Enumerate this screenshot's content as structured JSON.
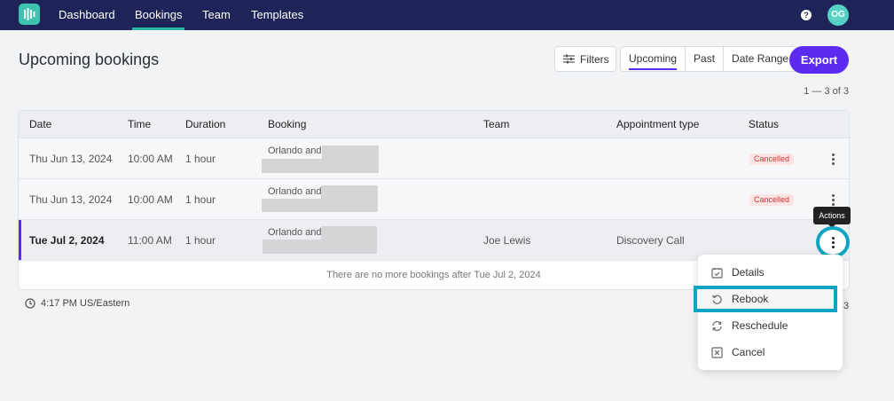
{
  "nav": {
    "items": [
      {
        "label": "Dashboard"
      },
      {
        "label": "Bookings"
      },
      {
        "label": "Team"
      },
      {
        "label": "Templates"
      }
    ],
    "help_label": "?",
    "avatar_initials": "OG",
    "accent": "#27b6a8",
    "bg": "#1f2458"
  },
  "page": {
    "title": "Upcoming bookings",
    "filters_label": "Filters",
    "tabs": [
      {
        "label": "Upcoming",
        "active": true
      },
      {
        "label": "Past",
        "active": false
      },
      {
        "label": "Date Range",
        "active": false
      }
    ],
    "export_label": "Export",
    "pagination": "1 — 3 of 3",
    "brand_color": "#5b2bf0"
  },
  "table": {
    "headers": [
      "Date",
      "Time",
      "Duration",
      "Booking",
      "Team",
      "Appointment type",
      "Status"
    ],
    "rows": [
      {
        "date": "Thu Jun 13, 2024",
        "time": "10:00 AM",
        "duration": "1 hour",
        "booking": "Orlando and",
        "team": "",
        "appointment_type": "",
        "status": "Cancelled"
      },
      {
        "date": "Thu Jun 13, 2024",
        "time": "10:00 AM",
        "duration": "1 hour",
        "booking": "Orlando and",
        "team": "",
        "appointment_type": "",
        "status": "Cancelled"
      },
      {
        "date": "Tue Jul 2, 2024",
        "time": "11:00 AM",
        "duration": "1 hour",
        "booking": "Orlando and",
        "team": "Joe Lewis",
        "appointment_type": "Discovery Call",
        "status": ""
      }
    ],
    "empty_message": "There are no more bookings after Tue Jul 2, 2024"
  },
  "tooltip": "Actions",
  "timezone": "4:17 PM US/Eastern",
  "footer_count_fragment": "3",
  "menu": {
    "items": [
      {
        "label": "Details",
        "icon": "checklist-icon"
      },
      {
        "label": "Rebook",
        "icon": "rotate-ccw-icon",
        "highlighted": true
      },
      {
        "label": "Reschedule",
        "icon": "refresh-icon"
      },
      {
        "label": "Cancel",
        "icon": "x-square-icon"
      }
    ]
  },
  "colors": {
    "cancelled_bg": "#fde4e4",
    "cancelled_text": "#d03535",
    "focus_ring": "#0ea5c4"
  }
}
